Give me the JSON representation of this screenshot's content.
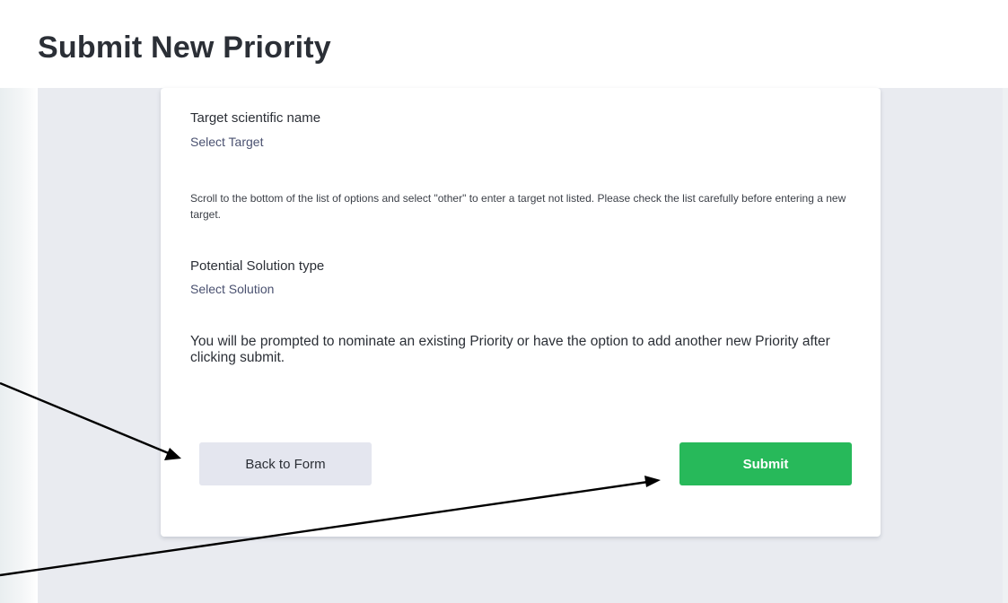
{
  "page": {
    "title": "Submit New Priority"
  },
  "form": {
    "target": {
      "label": "Target scientific name",
      "value": "Select Target",
      "help": "Scroll to the bottom of the list of options and select \"other\" to enter a target not listed. Please check the list carefully before entering a new target."
    },
    "solution": {
      "label": "Potential Solution type",
      "value": "Select Solution"
    },
    "notice": "You will be prompted to nominate an existing Priority or have the option to add another new Priority after clicking submit.",
    "buttons": {
      "back_label": "Back to Form",
      "submit_label": "Submit"
    }
  },
  "colors": {
    "submit_accent": "#27b95a",
    "back_button_bg": "#e4e6ef",
    "content_bg": "#e9ebf0"
  },
  "annotations": {
    "arrow_count": 2,
    "arrow_color": "#000000"
  }
}
